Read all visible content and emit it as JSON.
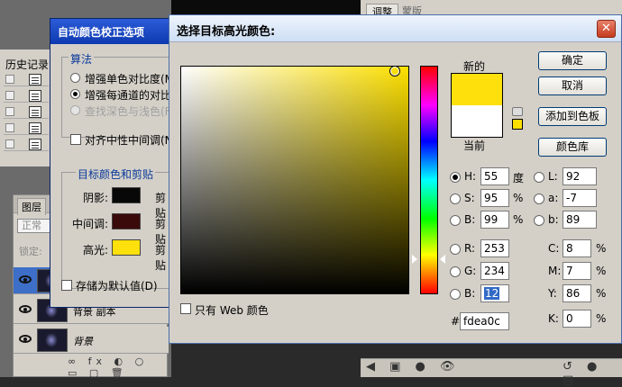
{
  "background": {
    "history_title": "历史记录",
    "layers_tab": "图层",
    "blend_mode": "正常",
    "lock_label": "锁定:",
    "layers": [
      {
        "name": "",
        "selected": true
      },
      {
        "name": "背景 副本",
        "selected": false
      },
      {
        "name": "背景",
        "selected": false
      }
    ],
    "adjust_tab": "调整",
    "mask_tab": "蒙版"
  },
  "acc_dialog": {
    "title": "自动颜色校正选项",
    "algo_group": "算法",
    "options": [
      {
        "label": "增强单色对比度(M",
        "selected": false,
        "disabled": false
      },
      {
        "label": "增强每通道的对比",
        "selected": true,
        "disabled": false
      },
      {
        "label": "查找深色与浅色(F",
        "selected": false,
        "disabled": true
      }
    ],
    "snap_neutral": "对齐中性中间调(N",
    "target_group": "目标颜色和剪贴",
    "targets": [
      {
        "label": "阴影:",
        "color": "#080808",
        "clip": "剪贴"
      },
      {
        "label": "中间调:",
        "color": "#3a0a0a",
        "clip": "剪贴"
      },
      {
        "label": "高光:",
        "color": "#fde00c",
        "clip": "剪贴"
      }
    ],
    "save_default": "存储为默认值(D)"
  },
  "color_picker": {
    "title": "选择目标高光颜色:",
    "close": "✕",
    "new_label": "新的",
    "current_label": "当前",
    "new_color": "#fde00c",
    "current_color": "#ffffff",
    "buttons": {
      "ok": "确定",
      "cancel": "取消",
      "add_swatch": "添加到色板",
      "libraries": "颜色库"
    },
    "hsb": [
      {
        "label": "H:",
        "value": "55",
        "unit": "度",
        "selected": true
      },
      {
        "label": "S:",
        "value": "95",
        "unit": "%",
        "selected": false
      },
      {
        "label": "B:",
        "value": "99",
        "unit": "%",
        "selected": false
      }
    ],
    "rgb": [
      {
        "label": "R:",
        "value": "253"
      },
      {
        "label": "G:",
        "value": "234"
      },
      {
        "label": "B:",
        "value": "12"
      }
    ],
    "lab": [
      {
        "label": "L:",
        "value": "92"
      },
      {
        "label": "a:",
        "value": "-7"
      },
      {
        "label": "b:",
        "value": "89"
      }
    ],
    "cmyk": [
      {
        "label": "C:",
        "value": "8",
        "unit": "%"
      },
      {
        "label": "M:",
        "value": "7",
        "unit": "%"
      },
      {
        "label": "Y:",
        "value": "86",
        "unit": "%"
      },
      {
        "label": "K:",
        "value": "0",
        "unit": "%"
      }
    ],
    "hex_label": "#",
    "hex": "fdea0c",
    "web_only": "只有 Web 颜色"
  }
}
